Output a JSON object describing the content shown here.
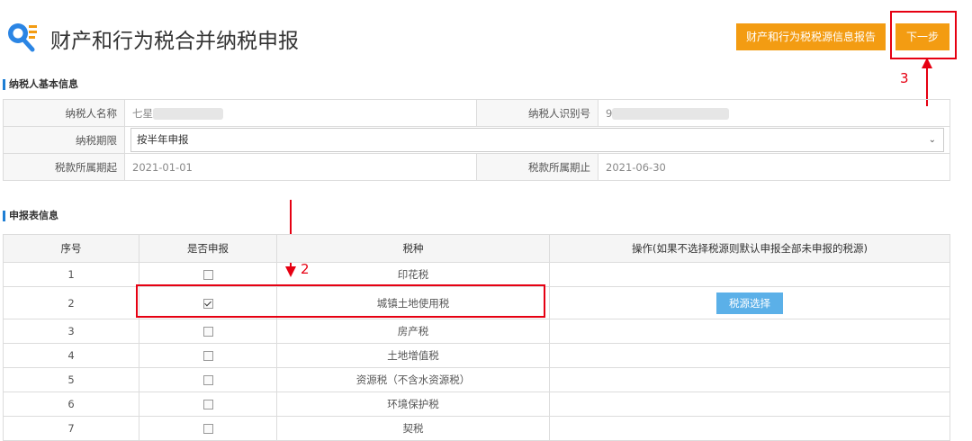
{
  "header": {
    "title": "财产和行为税合并纳税申报",
    "report_button": "财产和行为税税源信息报告",
    "next_button": "下一步"
  },
  "taxpayer_section": {
    "title": "纳税人基本信息",
    "name_label": "纳税人名称",
    "name_value": "七星",
    "id_label": "纳税人识别号",
    "id_value": "9",
    "period_label": "纳税期限",
    "period_value": "按半年申报",
    "start_label": "税款所属期起",
    "start_value": "2021-01-01",
    "end_label": "税款所属期止",
    "end_value": "2021-06-30"
  },
  "declaration_section": {
    "title": "申报表信息",
    "columns": [
      "序号",
      "是否申报",
      "税种",
      "操作(如果不选择税源则默认申报全部未申报的税源)"
    ],
    "rows": [
      {
        "no": "1",
        "checked": false,
        "tax": "印花税"
      },
      {
        "no": "2",
        "checked": true,
        "tax": "城镇土地使用税",
        "action": "税源选择"
      },
      {
        "no": "3",
        "checked": false,
        "tax": "房产税"
      },
      {
        "no": "4",
        "checked": false,
        "tax": "土地增值税"
      },
      {
        "no": "5",
        "checked": false,
        "tax": "资源税（不含水资源税）"
      },
      {
        "no": "6",
        "checked": false,
        "tax": "环境保护税"
      },
      {
        "no": "7",
        "checked": false,
        "tax": "契税"
      }
    ]
  },
  "annotations": {
    "one": "2",
    "two": "3"
  },
  "colors": {
    "accent_orange": "#f39c12",
    "accent_blue": "#5bb0e8",
    "annotation_red": "#e60012",
    "section_bar": "#1e7ed4"
  }
}
